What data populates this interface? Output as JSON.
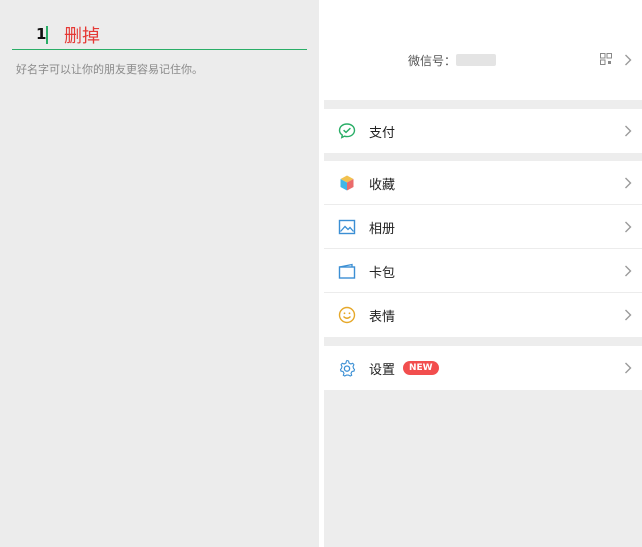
{
  "edit_name": {
    "name_value": "1",
    "delete_label": "删掉",
    "hint": "好名字可以让你的朋友更容易记住你。"
  },
  "me": {
    "wechat_id_label": "微信号：",
    "groups": [
      {
        "items": [
          {
            "label": "支付",
            "icon": "wechat-pay-icon"
          }
        ]
      },
      {
        "items": [
          {
            "label": "收藏",
            "icon": "favorites-cube-icon"
          },
          {
            "label": "相册",
            "icon": "album-icon"
          },
          {
            "label": "卡包",
            "icon": "card-wallet-icon"
          },
          {
            "label": "表情",
            "icon": "sticker-smile-icon"
          }
        ]
      },
      {
        "items": [
          {
            "label": "设置",
            "icon": "settings-gear-icon",
            "badge": "NEW"
          }
        ]
      }
    ]
  },
  "colors": {
    "accent_green": "#2aae67",
    "delete_red": "#e53935",
    "badge_red": "#f24e4e"
  }
}
